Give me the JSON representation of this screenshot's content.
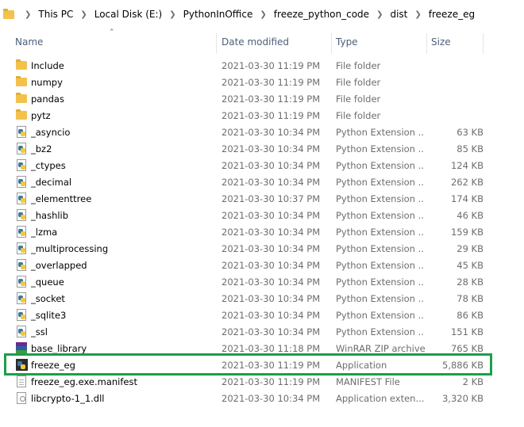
{
  "breadcrumb": [
    "This PC",
    "Local Disk (E:)",
    "PythonInOffice",
    "freeze_python_code",
    "dist",
    "freeze_eg"
  ],
  "columns": {
    "name": "Name",
    "date": "Date modified",
    "type": "Type",
    "size": "Size"
  },
  "accent": "#1aa04a",
  "files": [
    {
      "name": "Include",
      "date": "2021-03-30 11:19 PM",
      "type": "File folder",
      "size": "",
      "icon": "folder-icon"
    },
    {
      "name": "numpy",
      "date": "2021-03-30 11:19 PM",
      "type": "File folder",
      "size": "",
      "icon": "folder-icon"
    },
    {
      "name": "pandas",
      "date": "2021-03-30 11:19 PM",
      "type": "File folder",
      "size": "",
      "icon": "folder-icon"
    },
    {
      "name": "pytz",
      "date": "2021-03-30 11:19 PM",
      "type": "File folder",
      "size": "",
      "icon": "folder-icon"
    },
    {
      "name": "_asyncio",
      "date": "2021-03-30 10:34 PM",
      "type": "Python Extension ...",
      "size": "63 KB",
      "icon": "python-extension-icon"
    },
    {
      "name": "_bz2",
      "date": "2021-03-30 10:34 PM",
      "type": "Python Extension ...",
      "size": "85 KB",
      "icon": "python-extension-icon"
    },
    {
      "name": "_ctypes",
      "date": "2021-03-30 10:34 PM",
      "type": "Python Extension ...",
      "size": "124 KB",
      "icon": "python-extension-icon"
    },
    {
      "name": "_decimal",
      "date": "2021-03-30 10:34 PM",
      "type": "Python Extension ...",
      "size": "262 KB",
      "icon": "python-extension-icon"
    },
    {
      "name": "_elementtree",
      "date": "2021-03-30 10:37 PM",
      "type": "Python Extension ...",
      "size": "174 KB",
      "icon": "python-extension-icon"
    },
    {
      "name": "_hashlib",
      "date": "2021-03-30 10:34 PM",
      "type": "Python Extension ...",
      "size": "46 KB",
      "icon": "python-extension-icon"
    },
    {
      "name": "_lzma",
      "date": "2021-03-30 10:34 PM",
      "type": "Python Extension ...",
      "size": "159 KB",
      "icon": "python-extension-icon"
    },
    {
      "name": "_multiprocessing",
      "date": "2021-03-30 10:34 PM",
      "type": "Python Extension ...",
      "size": "29 KB",
      "icon": "python-extension-icon"
    },
    {
      "name": "_overlapped",
      "date": "2021-03-30 10:34 PM",
      "type": "Python Extension ...",
      "size": "45 KB",
      "icon": "python-extension-icon"
    },
    {
      "name": "_queue",
      "date": "2021-03-30 10:34 PM",
      "type": "Python Extension ...",
      "size": "28 KB",
      "icon": "python-extension-icon"
    },
    {
      "name": "_socket",
      "date": "2021-03-30 10:34 PM",
      "type": "Python Extension ...",
      "size": "78 KB",
      "icon": "python-extension-icon"
    },
    {
      "name": "_sqlite3",
      "date": "2021-03-30 10:34 PM",
      "type": "Python Extension ...",
      "size": "86 KB",
      "icon": "python-extension-icon"
    },
    {
      "name": "_ssl",
      "date": "2021-03-30 10:34 PM",
      "type": "Python Extension ...",
      "size": "151 KB",
      "icon": "python-extension-icon"
    },
    {
      "name": "base_library",
      "date": "2021-03-30 11:18 PM",
      "type": "WinRAR ZIP archive",
      "size": "765 KB",
      "icon": "winrar-zip-icon"
    },
    {
      "name": "freeze_eg",
      "date": "2021-03-30 11:19 PM",
      "type": "Application",
      "size": "5,886 KB",
      "icon": "application-icon"
    },
    {
      "name": "freeze_eg.exe.manifest",
      "date": "2021-03-30 11:19 PM",
      "type": "MANIFEST File",
      "size": "2 KB",
      "icon": "manifest-file-icon"
    },
    {
      "name": "libcrypto-1_1.dll",
      "date": "2021-03-30 10:34 PM",
      "type": "Application exten...",
      "size": "3,320 KB",
      "icon": "dll-file-icon"
    }
  ]
}
